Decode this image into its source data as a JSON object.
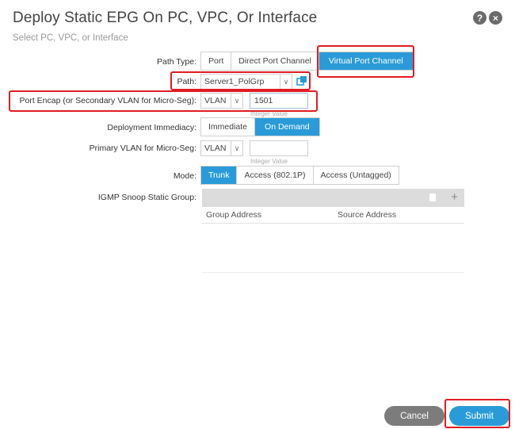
{
  "dialog": {
    "title": "Deploy Static EPG On PC, VPC, Or Interface",
    "subtitle": "Select PC, VPC, or Interface",
    "help_icon": "?",
    "close_icon": "×"
  },
  "form": {
    "path_type": {
      "label": "Path Type:",
      "options": [
        "Port",
        "Direct Port Channel",
        "Virtual Port Channel"
      ],
      "selected": "Virtual Port Channel"
    },
    "path": {
      "label": "Path:",
      "value": "Server1_PolGrp",
      "chevron": "∨"
    },
    "port_encap": {
      "label": "Port Encap (or Secondary VLAN for Micro-Seg):",
      "type_value": "VLAN",
      "chevron": "∨",
      "value": "1501",
      "hint": "Integer Value"
    },
    "deployment_immediacy": {
      "label": "Deployment Immediacy:",
      "options": [
        "Immediate",
        "On Demand"
      ],
      "selected": "On Demand"
    },
    "primary_vlan": {
      "label": "Primary VLAN for Micro-Seg:",
      "type_value": "VLAN",
      "chevron": "∨",
      "value": "",
      "hint": "Integer Value"
    },
    "mode": {
      "label": "Mode:",
      "options": [
        "Trunk",
        "Access (802.1P)",
        "Access (Untagged)"
      ],
      "selected": "Trunk"
    },
    "igmp": {
      "label": "IGMP Snoop Static Group:",
      "plus_icon": "+",
      "columns": [
        "Group Address",
        "Source Address"
      ]
    }
  },
  "footer": {
    "cancel_label": "Cancel",
    "submit_label": "Submit"
  },
  "colors": {
    "accent": "#2a9bd8",
    "highlight": "#e01c24",
    "cancel": "#7c7c7c"
  }
}
